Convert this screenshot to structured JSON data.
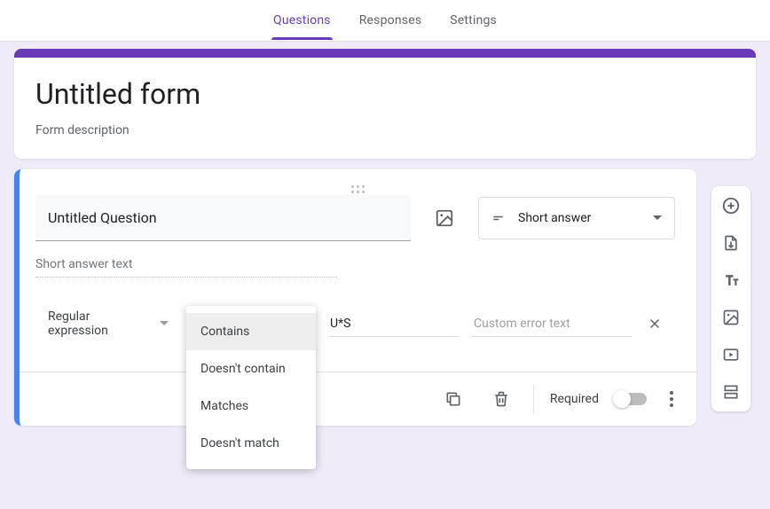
{
  "tabs": {
    "questions": "Questions",
    "responses": "Responses",
    "settings": "Settings"
  },
  "form": {
    "title": "Untitled form",
    "description": "Form description"
  },
  "question": {
    "title": "Untitled Question",
    "type_label": "Short answer",
    "answer_placeholder": "Short answer text",
    "validation": {
      "type_label": "Regular expression",
      "pattern": "U*S",
      "error_placeholder": "Custom error text",
      "options": [
        "Contains",
        "Doesn't contain",
        "Matches",
        "Doesn't match"
      ],
      "selected": "Contains"
    },
    "required_label": "Required"
  }
}
